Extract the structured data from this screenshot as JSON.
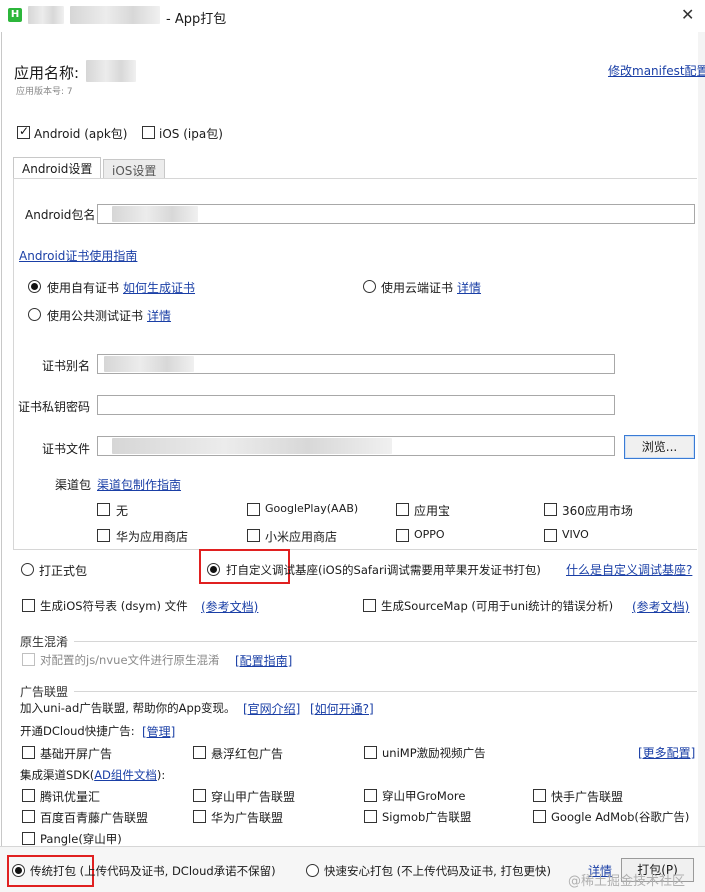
{
  "window": {
    "title": "- App打包",
    "close_icon": "✕"
  },
  "header": {
    "app_name_label": "应用名称:",
    "version_label": "应用版本号: 7",
    "manifest_link": "修改manifest配置"
  },
  "platforms": [
    {
      "label": "Android (apk包)",
      "checked": true
    },
    {
      "label": "iOS (ipa包)",
      "checked": false
    }
  ],
  "tabs": [
    {
      "label": "Android设置",
      "active": true
    },
    {
      "label": "iOS设置",
      "active": false
    }
  ],
  "android": {
    "package_label": "Android包名",
    "cert_guide_link": "Android证书使用指南",
    "cert_options": {
      "own": "使用自有证书",
      "own_link": "如何生成证书",
      "cloud": "使用云端证书",
      "cloud_link": "详情",
      "public": "使用公共测试证书",
      "public_link": "详情"
    },
    "alias_label": "证书别名",
    "password_label": "证书私钥密码",
    "file_label": "证书文件",
    "browse_button": "浏览...",
    "channel_label": "渠道包",
    "channel_link": "渠道包制作指南",
    "channels": [
      "无",
      "GooglePlay(AAB)",
      "应用宝",
      "360应用市场",
      "华为应用商店",
      "小米应用商店",
      "OPPO",
      "VIVO"
    ]
  },
  "build_type": {
    "formal": "打正式包",
    "custom_base": "打自定义调试基座(iOS的Safari调试需要用苹果开发证书打包)",
    "custom_base_link": "什么是自定义调试基座?"
  },
  "options": {
    "dsym": "生成iOS符号表 (dsym) 文件",
    "dsym_link": "(参考文档)",
    "sourcemap": "生成SourceMap (可用于uni统计的错误分析)",
    "sourcemap_link": "(参考文档)"
  },
  "obfuscation": {
    "title": "原生混淆",
    "option": "对配置的js/nvue文件进行原生混淆",
    "link": "[配置指南]"
  },
  "ads": {
    "title": "广告联盟",
    "intro": "加入uni-ad广告联盟, 帮助你的App变现。",
    "intro_link1": "[官网介绍]",
    "intro_link2": "[如何开通?]",
    "dcloud_label": "开通DCloud快捷广告:",
    "manage_link": "[管理]",
    "dcloud_options": [
      "基础开屏广告",
      "悬浮红包广告",
      "uniMP激励视频广告"
    ],
    "more_link": "[更多配置]",
    "sdk_label_pre": "集成渠道SDK(",
    "sdk_label_link": "AD组件文档",
    "sdk_label_post": "):",
    "sdk_options": [
      "腾讯优量汇",
      "穿山甲广告联盟",
      "穿山甲GroMore",
      "快手广告联盟",
      "百度百青藤广告联盟",
      "华为广告联盟",
      "Sigmob广告联盟",
      "Google AdMob(谷歌广告)",
      "Pangle(穿山甲)"
    ]
  },
  "footer": {
    "traditional": "传统打包 (上传代码及证书, DCloud承诺不保留)",
    "fast": "快速安心打包 (不上传代码及证书, 打包更快)",
    "detail_link": "详情",
    "build_button": "打包(P)",
    "watermark": "@稀土掘金技术社区"
  }
}
